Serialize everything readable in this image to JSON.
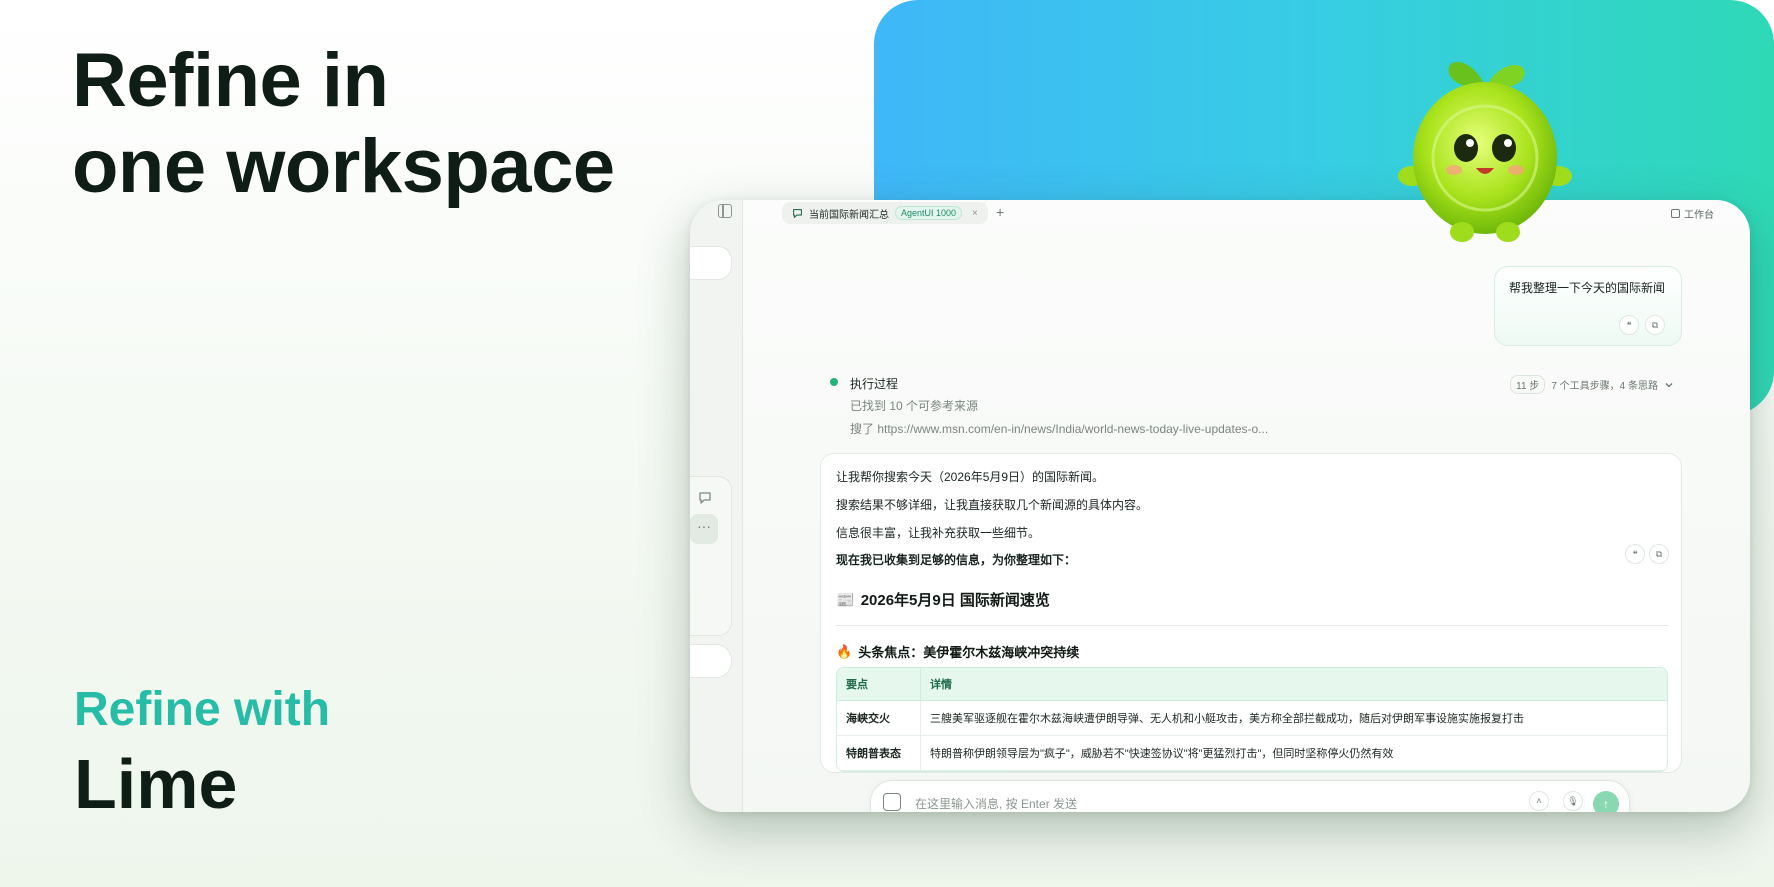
{
  "hero": {
    "line1": "Refine in",
    "line2": "one workspace",
    "refine_with": "Refine with",
    "brand": "Lime"
  },
  "colors": {
    "accent_teal": "#27bca5",
    "gradient_start": "#3fb7f8",
    "gradient_end": "#2ed9b6",
    "success_green": "#22b37a"
  },
  "window": {
    "sidebar": {
      "back_icon": "chevron-left-icon",
      "collapse_icon": "sidebar-toggle-icon",
      "chat_icon": "chat-bubble-icon",
      "more_label": "···"
    },
    "tab": {
      "icon": "chat-bubble-icon",
      "title": "当前国际新闻汇总",
      "badge": "AgentUI 1000",
      "close": "×",
      "add": "+"
    },
    "workbench_label": "工作台",
    "user_message": "帮我整理一下今天的国际新闻",
    "process": {
      "title": "执行过程",
      "found": "已找到 10 个可参考来源",
      "searched": "搜了 https://www.msn.com/en-in/news/India/world-news-today-live-updates-o...",
      "steps": "11 步",
      "summary": "7 个工具步骤，4 条思路"
    },
    "response": {
      "line1": "让我帮你搜索今天（2026年5月9日）的国际新闻。",
      "line2": "搜索结果不够详细，让我直接获取几个新闻源的具体内容。",
      "line3": "信息很丰富，让我补充获取一些细节。",
      "line4": "现在我已收集到足够的信息，为你整理如下：",
      "heading_emoji": "📰",
      "heading": "2026年5月9日 国际新闻速览",
      "section_emoji": "🔥",
      "section": "头条焦点：美伊霍尔木兹海峡冲突持续",
      "table": {
        "headers": [
          "要点",
          "详情"
        ],
        "rows": [
          [
            "海峡交火",
            "三艘美军驱逐舰在霍尔木兹海峡遭伊朗导弹、无人机和小艇攻击，美方称全部拦截成功，随后对伊朗军事设施实施报复打击"
          ],
          [
            "特朗普表态",
            "特朗普称伊朗领导层为\"疯子\"，威胁若不\"快速签协议\"将\"更猛烈打击\"，但同时坚称停火仍然有效"
          ]
        ]
      }
    },
    "composer": {
      "placeholder": "在这里输入消息, 按 Enter 发送"
    }
  }
}
